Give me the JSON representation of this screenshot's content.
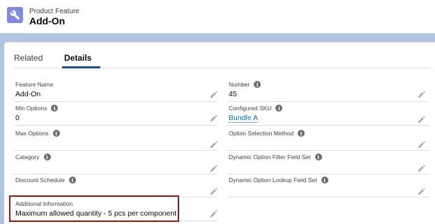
{
  "header": {
    "object_type": "Product Feature",
    "record_name": "Add-On",
    "icon": "wrench-icon"
  },
  "tabs": [
    {
      "label": "Related",
      "active": false
    },
    {
      "label": "Details",
      "active": true
    }
  ],
  "fields_left": [
    {
      "label": "Feature Name",
      "value": "Add-On",
      "info": false
    },
    {
      "label": "Min Options",
      "value": "0",
      "info": true
    },
    {
      "label": "Max Options",
      "value": "",
      "info": true
    },
    {
      "label": "Category",
      "value": "",
      "info": true
    },
    {
      "label": "Discount Schedule",
      "value": "",
      "info": true
    },
    {
      "label": "Additional Information",
      "value": "Maximum allowed quantity - 5 pcs per component",
      "info": false
    }
  ],
  "fields_right": [
    {
      "label": "Number",
      "value": "45",
      "info": true
    },
    {
      "label": "Configured SKU",
      "value": "Bundle A",
      "info": true,
      "link": true
    },
    {
      "label": "Option Selection Method",
      "value": "",
      "info": true
    },
    {
      "label": "Dynamic Option Filter Field Set",
      "value": "",
      "info": true
    },
    {
      "label": "Dynamic Option Lookup Field Set",
      "value": "",
      "info": true
    }
  ],
  "colors": {
    "page_background": "#b0c4df",
    "active_tab": "#1b5297",
    "link": "#006dcc",
    "highlight_border": "#8b1a1a",
    "icon_background": "#7e8be4"
  }
}
